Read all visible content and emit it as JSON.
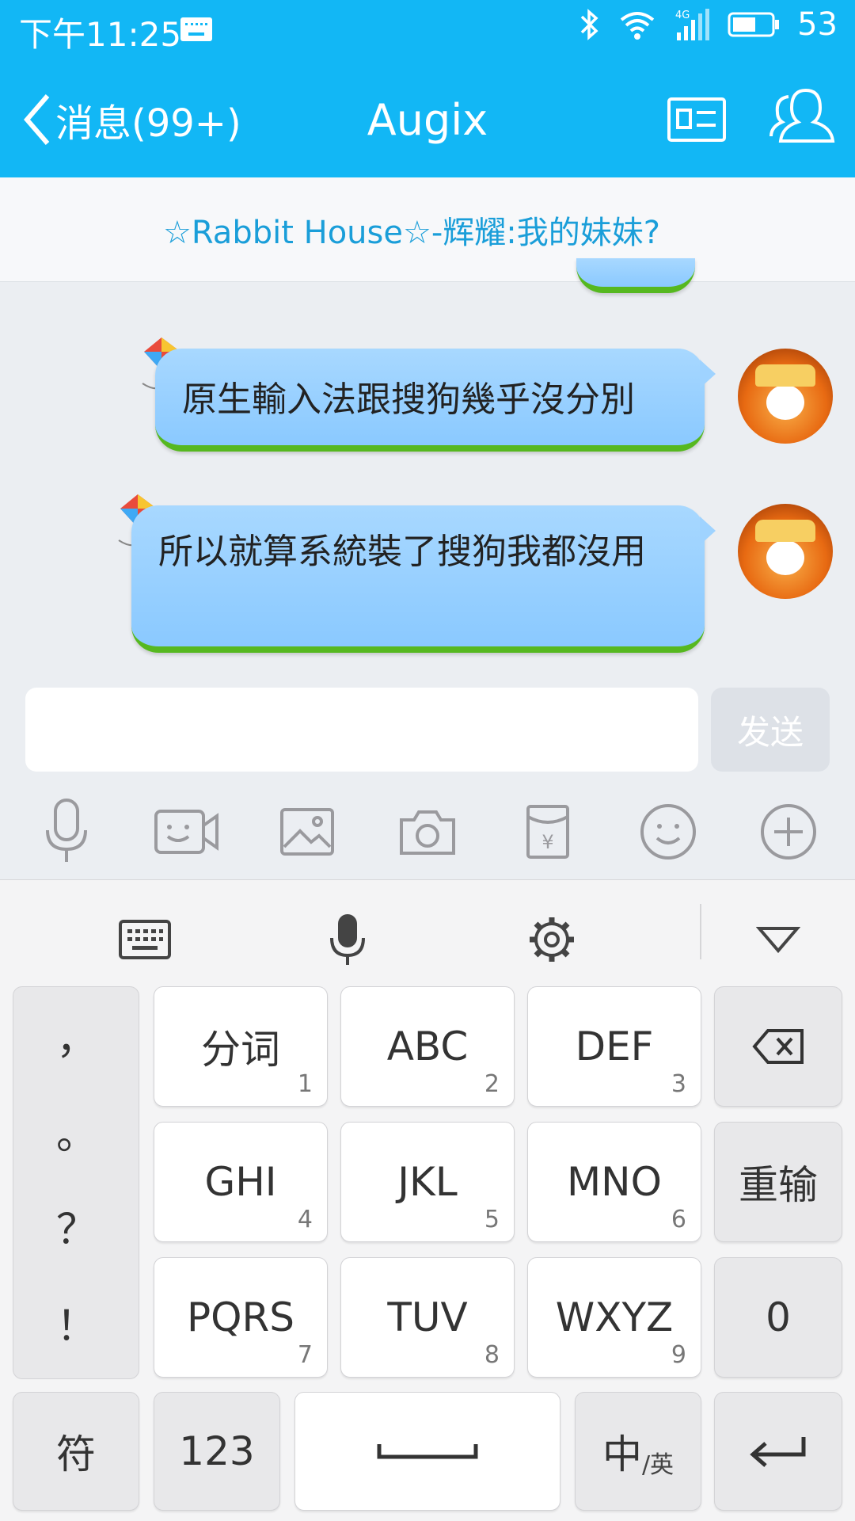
{
  "status_bar": {
    "time": "下午11:25",
    "battery": "53"
  },
  "nav": {
    "back_label": "消息(99+)",
    "title": "Augix"
  },
  "notice": {
    "text": "☆Rabbit House☆-辉耀:我的妹妹?"
  },
  "messages": [
    {
      "text": "原生輸入法跟搜狗幾乎沒分別"
    },
    {
      "text": "所以就算系統裝了搜狗我都沒用"
    }
  ],
  "composer": {
    "placeholder": "",
    "send_label": "发送"
  },
  "keyboard": {
    "punctuation": [
      "，",
      "。",
      "？",
      "！"
    ],
    "rows": [
      [
        {
          "label": "分词",
          "num": "1"
        },
        {
          "label": "ABC",
          "num": "2"
        },
        {
          "label": "DEF",
          "num": "3"
        }
      ],
      [
        {
          "label": "GHI",
          "num": "4"
        },
        {
          "label": "JKL",
          "num": "5"
        },
        {
          "label": "MNO",
          "num": "6"
        }
      ],
      [
        {
          "label": "PQRS",
          "num": "7"
        },
        {
          "label": "TUV",
          "num": "8"
        },
        {
          "label": "WXYZ",
          "num": "9"
        }
      ]
    ],
    "reinput_label": "重输",
    "zero_label": "0",
    "symbol_label": "符",
    "num_label": "123",
    "lang_main": "中",
    "lang_sub": "/英"
  },
  "colors": {
    "accent": "#12b7f5",
    "bubble": "#8ac9ff",
    "grass": "#56b820"
  },
  "icons": [
    "keyboard-indicator-icon",
    "bluetooth-icon",
    "wifi-icon",
    "signal-icon",
    "battery-icon",
    "back-chevron-icon",
    "profile-card-icon",
    "contacts-icon",
    "voice-icon",
    "video-icon",
    "image-icon",
    "camera-icon",
    "red-packet-icon",
    "emoji-icon",
    "plus-icon",
    "keyboard-icon",
    "mic-icon",
    "settings-icon",
    "collapse-icon",
    "backspace-icon",
    "enter-icon",
    "space-icon"
  ]
}
